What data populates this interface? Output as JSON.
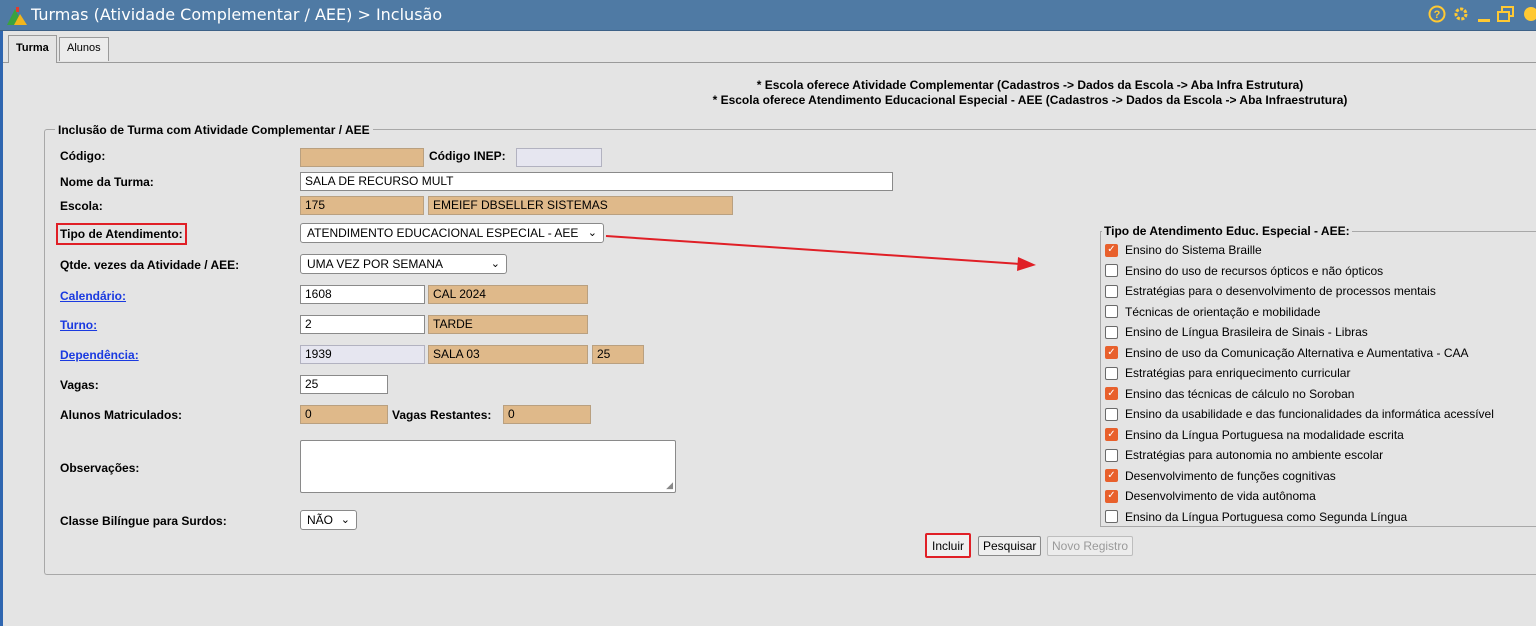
{
  "window": {
    "title": "Turmas (Atividade Complementar / AEE) > Inclusão",
    "controls": [
      "help-icon",
      "gear-icon",
      "minimize-icon",
      "restore-icon",
      "more-icon"
    ]
  },
  "tabs": [
    {
      "label": "Turma",
      "active": true
    },
    {
      "label": "Alunos",
      "active": false
    }
  ],
  "notes": [
    "* Escola oferece Atividade Complementar (Cadastros -> Dados da Escola -> Aba Infra Estrutura)",
    "* Escola oferece Atendimento Educacional Especial - AEE (Cadastros -> Dados da Escola -> Aba Infraestrutura)"
  ],
  "form": {
    "legend": "Inclusão de Turma com Atividade Complementar / AEE",
    "codigo": {
      "label": "Código:",
      "value": ""
    },
    "codigo_inep": {
      "label": "Código INEP:",
      "value": ""
    },
    "nome_turma": {
      "label": "Nome da Turma:",
      "value": "SALA DE RECURSO MULT"
    },
    "escola": {
      "label": "Escola:",
      "code": "175",
      "name": "EMEIEF DBSELLER SISTEMAS"
    },
    "tipo_atendimento": {
      "label": "Tipo de Atendimento:",
      "value": "ATENDIMENTO EDUCACIONAL ESPECIAL - AEE"
    },
    "qtde_vezes": {
      "label": "Qtde. vezes da Atividade / AEE:",
      "value": "UMA VEZ POR SEMANA"
    },
    "calendario": {
      "label": "Calendário:",
      "code": "1608",
      "name": "CAL 2024"
    },
    "turno": {
      "label": "Turno:",
      "code": "2",
      "name": "TARDE"
    },
    "dependencia": {
      "label": "Dependência:",
      "code": "1939",
      "name": "SALA 03",
      "capacity": "25"
    },
    "vagas": {
      "label": "Vagas:",
      "value": "25"
    },
    "alunos_matriculados": {
      "label": "Alunos Matriculados:",
      "value": "0"
    },
    "vagas_restantes": {
      "label": "Vagas Restantes:",
      "value": "0"
    },
    "observacoes": {
      "label": "Observações:",
      "value": ""
    },
    "classe_bilingue": {
      "label": "Classe Bilíngue para Surdos:",
      "value": "NÃO"
    }
  },
  "aee": {
    "legend": "Tipo de Atendimento Educ. Especial - AEE:",
    "options": [
      {
        "label": "Ensino do Sistema Braille",
        "checked": true
      },
      {
        "label": "Ensino do uso de recursos ópticos e não ópticos",
        "checked": false
      },
      {
        "label": "Estratégias para o desenvolvimento de processos mentais",
        "checked": false
      },
      {
        "label": "Técnicas de orientação e mobilidade",
        "checked": false
      },
      {
        "label": "Ensino de Língua Brasileira de Sinais - Libras",
        "checked": false
      },
      {
        "label": "Ensino de uso da Comunicação Alternativa e Aumentativa - CAA",
        "checked": true
      },
      {
        "label": "Estratégias para enriquecimento curricular",
        "checked": false
      },
      {
        "label": "Ensino das técnicas de cálculo no Soroban",
        "checked": true
      },
      {
        "label": "Ensino da usabilidade e das funcionalidades da informática acessível",
        "checked": false
      },
      {
        "label": "Ensino da Língua Portuguesa na modalidade escrita",
        "checked": true
      },
      {
        "label": "Estratégias para autonomia no ambiente escolar",
        "checked": false
      },
      {
        "label": "Desenvolvimento de funções cognitivas",
        "checked": true
      },
      {
        "label": "Desenvolvimento de vida autônoma",
        "checked": true
      },
      {
        "label": "Ensino da Língua Portuguesa como Segunda Língua",
        "checked": false
      }
    ]
  },
  "buttons": {
    "incluir": "Incluir",
    "pesquisar": "Pesquisar",
    "novo_registro": "Novo Registro"
  },
  "colors": {
    "titlebar": "#4f7aa4",
    "readonly_field": "#dfb98a",
    "checkbox_checked": "#e8602c",
    "highlight": "#e01f26",
    "link": "#1a3ae0"
  }
}
